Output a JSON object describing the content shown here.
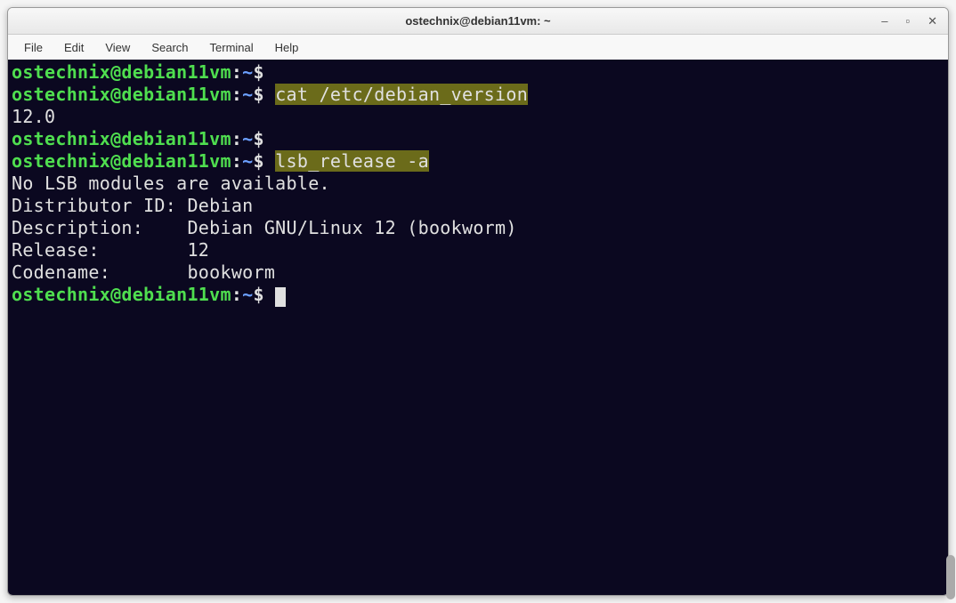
{
  "window": {
    "title": "ostechnix@debian11vm: ~"
  },
  "menubar": {
    "items": [
      "File",
      "Edit",
      "View",
      "Search",
      "Terminal",
      "Help"
    ]
  },
  "prompt": {
    "user": "ostechnix@debian11vm",
    "colon": ":",
    "path": "~",
    "symbol": "$"
  },
  "terminal": {
    "lines": [
      {
        "type": "prompt",
        "cmd": "",
        "highlight": false
      },
      {
        "type": "prompt",
        "cmd": "cat /etc/debian_version",
        "highlight": true
      },
      {
        "type": "output",
        "text": "12.0"
      },
      {
        "type": "prompt",
        "cmd": "",
        "highlight": false
      },
      {
        "type": "prompt",
        "cmd": "lsb_release -a",
        "highlight": true
      },
      {
        "type": "output",
        "text": "No LSB modules are available."
      },
      {
        "type": "output",
        "text": "Distributor ID: Debian"
      },
      {
        "type": "output",
        "text": "Description:    Debian GNU/Linux 12 (bookworm)"
      },
      {
        "type": "output",
        "text": "Release:        12"
      },
      {
        "type": "output",
        "text": "Codename:       bookworm"
      },
      {
        "type": "prompt",
        "cmd": "",
        "highlight": false,
        "cursor": true
      }
    ]
  },
  "win_controls": {
    "minimize": "–",
    "maximize": "▫",
    "close": "✕"
  }
}
